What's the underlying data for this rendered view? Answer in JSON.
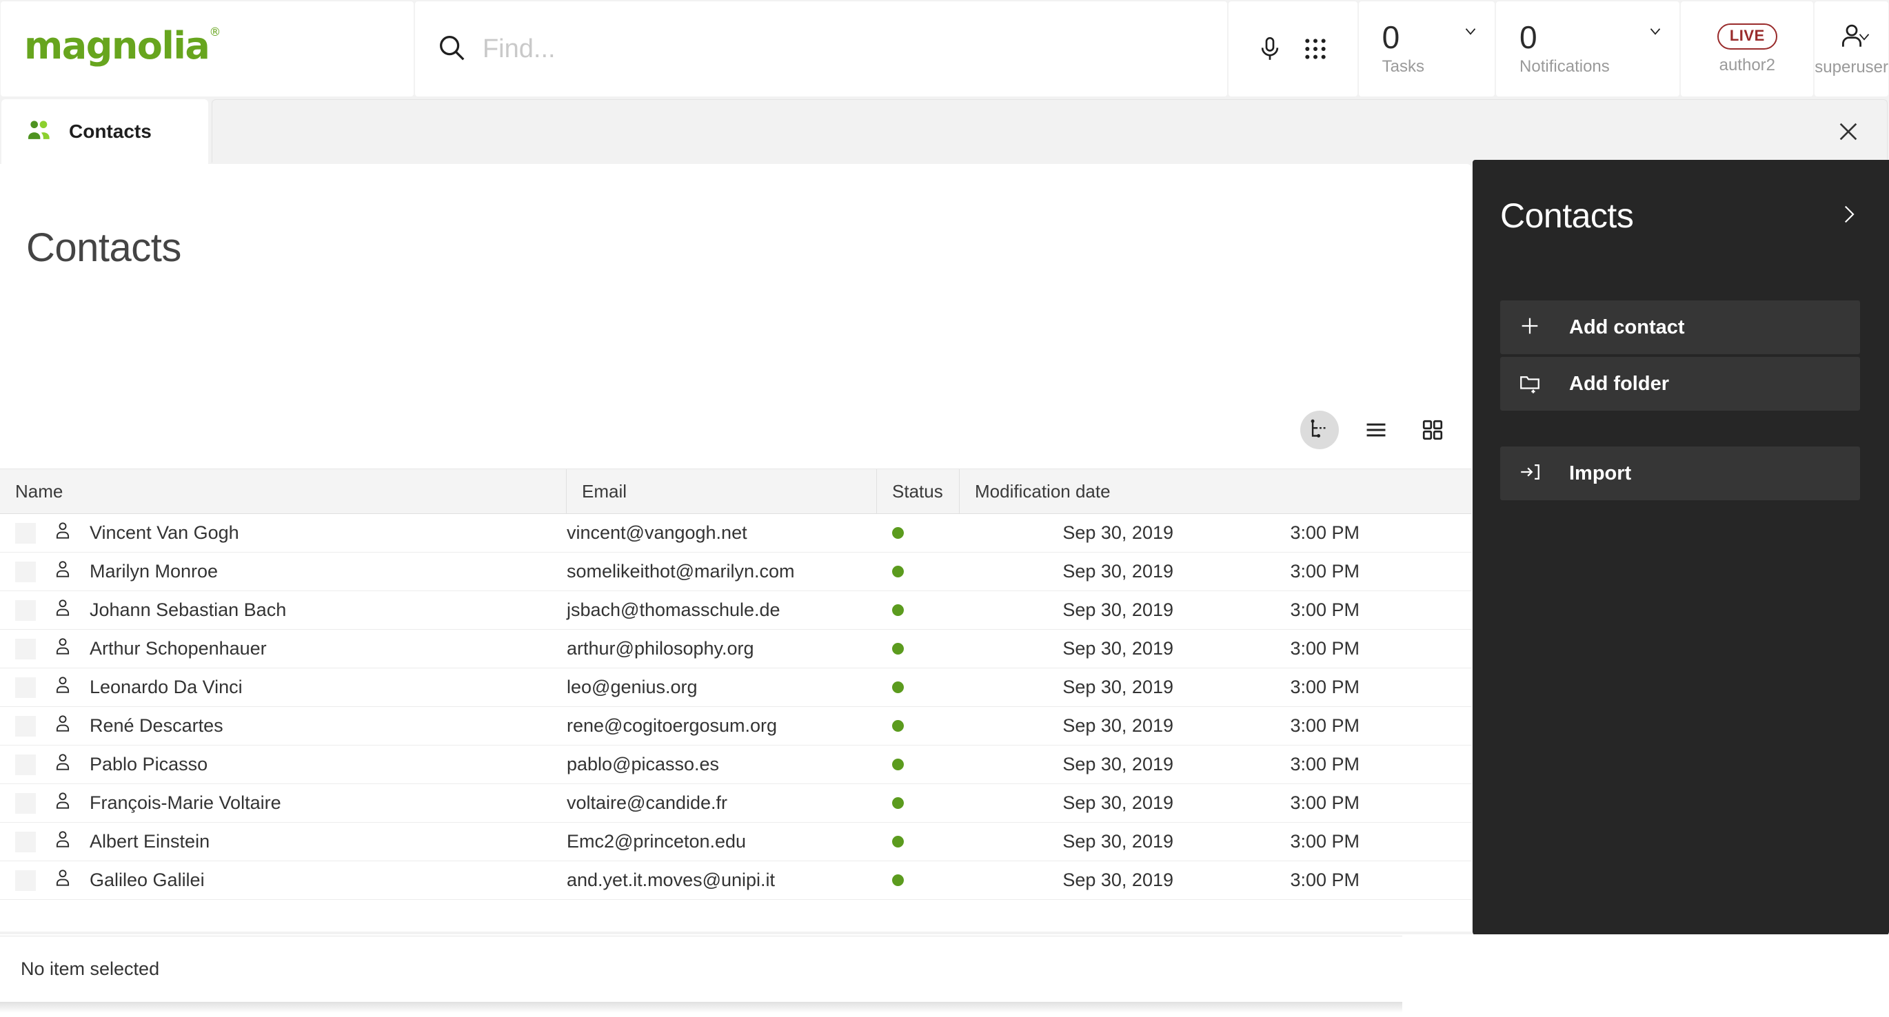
{
  "header": {
    "logo_text": "magnolia",
    "logo_trademark": "®",
    "logo_color": "#67a51e",
    "search": {
      "placeholder": "Find...",
      "value": "",
      "icon": "search-icon"
    },
    "mic_icon": "microphone-icon",
    "apps_icon": "app-grid-icon",
    "tasks": {
      "count": "0",
      "label": "Tasks"
    },
    "notifications": {
      "count": "0",
      "label": "Notifications"
    },
    "live": {
      "badge": "LIVE",
      "label": "author2",
      "color": "#992b2b"
    },
    "user": {
      "label": "superuser",
      "icon": "person-icon"
    }
  },
  "tabbar": {
    "tab_label": "Contacts",
    "tab_icon": "contacts-people-icon",
    "close_icon": "close-icon"
  },
  "main": {
    "page_title": "Contacts",
    "view_toggles": [
      {
        "name": "tree-view-toggle",
        "icon": "tree-view-icon",
        "active": true
      },
      {
        "name": "list-view-toggle",
        "icon": "list-view-icon",
        "active": false
      },
      {
        "name": "thumbnail-view-toggle",
        "icon": "grid-view-icon",
        "active": false
      }
    ],
    "table": {
      "columns": [
        "Name",
        "Email",
        "Status",
        "Modification date"
      ],
      "rows": [
        {
          "name": "Vincent Van Gogh",
          "email": "vincent@vangogh.net",
          "status_color": "#5b9b1e",
          "date": "Sep 30, 2019",
          "time": "3:00 PM"
        },
        {
          "name": "Marilyn Monroe",
          "email": "somelikeithot@marilyn.com",
          "status_color": "#5b9b1e",
          "date": "Sep 30, 2019",
          "time": "3:00 PM"
        },
        {
          "name": "Johann Sebastian Bach",
          "email": "jsbach@thomasschule.de",
          "status_color": "#5b9b1e",
          "date": "Sep 30, 2019",
          "time": "3:00 PM"
        },
        {
          "name": "Arthur Schopenhauer",
          "email": "arthur@philosophy.org",
          "status_color": "#5b9b1e",
          "date": "Sep 30, 2019",
          "time": "3:00 PM"
        },
        {
          "name": "Leonardo Da Vinci",
          "email": "leo@genius.org",
          "status_color": "#5b9b1e",
          "date": "Sep 30, 2019",
          "time": "3:00 PM"
        },
        {
          "name": "René Descartes",
          "email": "rene@cogitoergosum.org",
          "status_color": "#5b9b1e",
          "date": "Sep 30, 2019",
          "time": "3:00 PM"
        },
        {
          "name": "Pablo Picasso",
          "email": "pablo@picasso.es",
          "status_color": "#5b9b1e",
          "date": "Sep 30, 2019",
          "time": "3:00 PM"
        },
        {
          "name": "François-Marie Voltaire",
          "email": "voltaire@candide.fr",
          "status_color": "#5b9b1e",
          "date": "Sep 30, 2019",
          "time": "3:00 PM"
        },
        {
          "name": "Albert Einstein",
          "email": "Emc2@princeton.edu",
          "status_color": "#5b9b1e",
          "date": "Sep 30, 2019",
          "time": "3:00 PM"
        },
        {
          "name": "Galileo Galilei",
          "email": "and.yet.it.moves@unipi.it",
          "status_color": "#5b9b1e",
          "date": "Sep 30, 2019",
          "time": "3:00 PM"
        }
      ]
    }
  },
  "panel": {
    "title": "Contacts",
    "expand_icon": "chevron-right-icon",
    "actions": [
      {
        "label": "Add contact",
        "icon": "plus-icon"
      },
      {
        "label": "Add folder",
        "icon": "folder-plus-icon"
      },
      {
        "label": "Import",
        "icon": "import-arrow-icon"
      }
    ]
  },
  "footer": {
    "status_text": "No item selected"
  }
}
